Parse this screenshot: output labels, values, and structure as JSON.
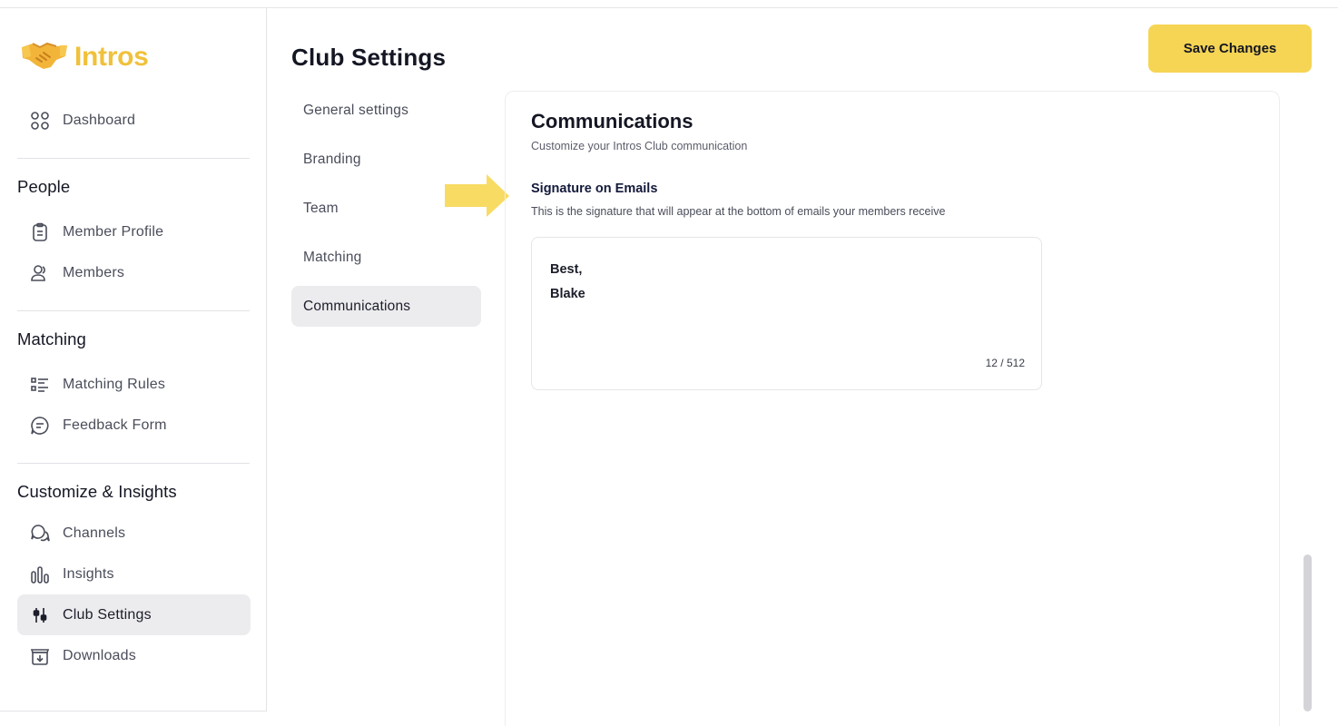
{
  "app": {
    "name": "Intros"
  },
  "sidebar": {
    "dashboard": {
      "label": "Dashboard",
      "icon": "dashboard-grid-icon"
    },
    "sections": [
      {
        "title": "People",
        "items": [
          {
            "label": "Member Profile",
            "icon": "clipboard-icon"
          },
          {
            "label": "Members",
            "icon": "members-icon"
          }
        ]
      },
      {
        "title": "Matching",
        "items": [
          {
            "label": "Matching Rules",
            "icon": "list-rules-icon"
          },
          {
            "label": "Feedback Form",
            "icon": "feedback-icon"
          }
        ]
      },
      {
        "title": "Customize & Insights",
        "items": [
          {
            "label": "Channels",
            "icon": "chat-bubbles-icon"
          },
          {
            "label": "Insights",
            "icon": "bar-chart-icon"
          },
          {
            "label": "Club Settings",
            "icon": "sliders-icon",
            "active": true
          },
          {
            "label": "Downloads",
            "icon": "download-box-icon"
          }
        ]
      }
    ]
  },
  "header": {
    "title": "Club Settings",
    "save_label": "Save Changes"
  },
  "settings_nav": [
    {
      "label": "General settings"
    },
    {
      "label": "Branding"
    },
    {
      "label": "Team"
    },
    {
      "label": "Matching"
    },
    {
      "label": "Communications",
      "active": true
    }
  ],
  "communications": {
    "title": "Communications",
    "subtitle": "Customize your Intros Club communication",
    "signature": {
      "label": "Signature on Emails",
      "help": "This is the signature that will appear at the bottom of emails your members receive",
      "lines": [
        "Best,",
        "Blake"
      ],
      "count": "12 / 512"
    }
  },
  "colors": {
    "accent": "#f6d554",
    "logo": "#f0c13b",
    "active_bg": "#ececee"
  }
}
